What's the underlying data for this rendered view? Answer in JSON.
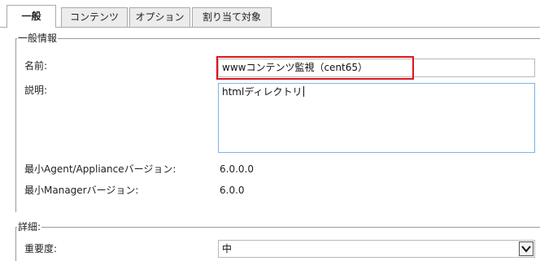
{
  "tabs": [
    {
      "label": "一般",
      "active": true
    },
    {
      "label": "コンテンツ",
      "active": false
    },
    {
      "label": "オプション",
      "active": false
    },
    {
      "label": "割り当て対象",
      "active": false
    }
  ],
  "general_info": {
    "legend": "一般情報",
    "name_label": "名前:",
    "name_value": "wwwコンテンツ監視（cent65）",
    "description_label": "説明:",
    "description_value": "htmlディレクトリ",
    "min_agent_label": "最小Agent/Applianceバージョン:",
    "min_agent_value": "6.0.0.0",
    "min_manager_label": "最小Managerバージョン:",
    "min_manager_value": "6.0.0"
  },
  "details": {
    "legend": "詳細:",
    "severity_label": "重要度:",
    "severity_value": "中",
    "dropdown_icon": "chevron-down-icon"
  },
  "colors": {
    "highlight": "#e0141e",
    "textarea_focus": "#7eb4ea"
  }
}
